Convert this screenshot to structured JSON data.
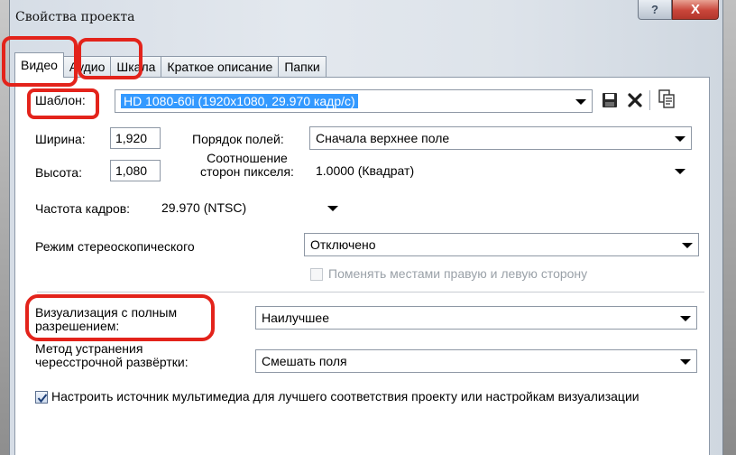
{
  "window": {
    "title": "Свойства проекта",
    "help_label": "?",
    "close_label": "X"
  },
  "tabs": [
    {
      "label": "Видео",
      "active": true
    },
    {
      "label": "Аудио",
      "active": false
    },
    {
      "label": "Шкала",
      "active": false
    },
    {
      "label": "Краткое описание",
      "active": false
    },
    {
      "label": "Папки",
      "active": false
    }
  ],
  "template": {
    "label": "Шаблон:",
    "value": "HD 1080-60i (1920x1080, 29.970 кадр/с)",
    "icons": [
      "save-icon",
      "delete-icon",
      "copy-icon"
    ]
  },
  "width": {
    "label": "Ширина:",
    "value": "1,920"
  },
  "height": {
    "label": "Высота:",
    "value": "1,080"
  },
  "field_order": {
    "label": "Порядок полей:",
    "value": "Сначала верхнее поле"
  },
  "pixel_aspect": {
    "label": "Соотношение сторон пикселя:",
    "value": "1.0000 (Квадрат)"
  },
  "frame_rate": {
    "label": "Частота кадров:",
    "value": "29.970 (NTSC)"
  },
  "stereo_mode": {
    "label": "Режим стереоскопического",
    "value": "Отключено",
    "swap_label": "Поменять местами правую и левую сторону",
    "swap_checked": false
  },
  "full_res_render": {
    "label": "Визуализация с полным разрешением:",
    "value": "Наилучшее"
  },
  "deinterlace": {
    "label": "Метод устранения чересстрочной развёртки:",
    "value": "Смешать поля"
  },
  "adjust_source": {
    "label": "Настроить источник мультимедиа для лучшего соответствия проекту или настройкам визуализации",
    "checked": true
  },
  "colors": {
    "accent": "#3399ff",
    "highlight_ring": "#e3231b"
  }
}
